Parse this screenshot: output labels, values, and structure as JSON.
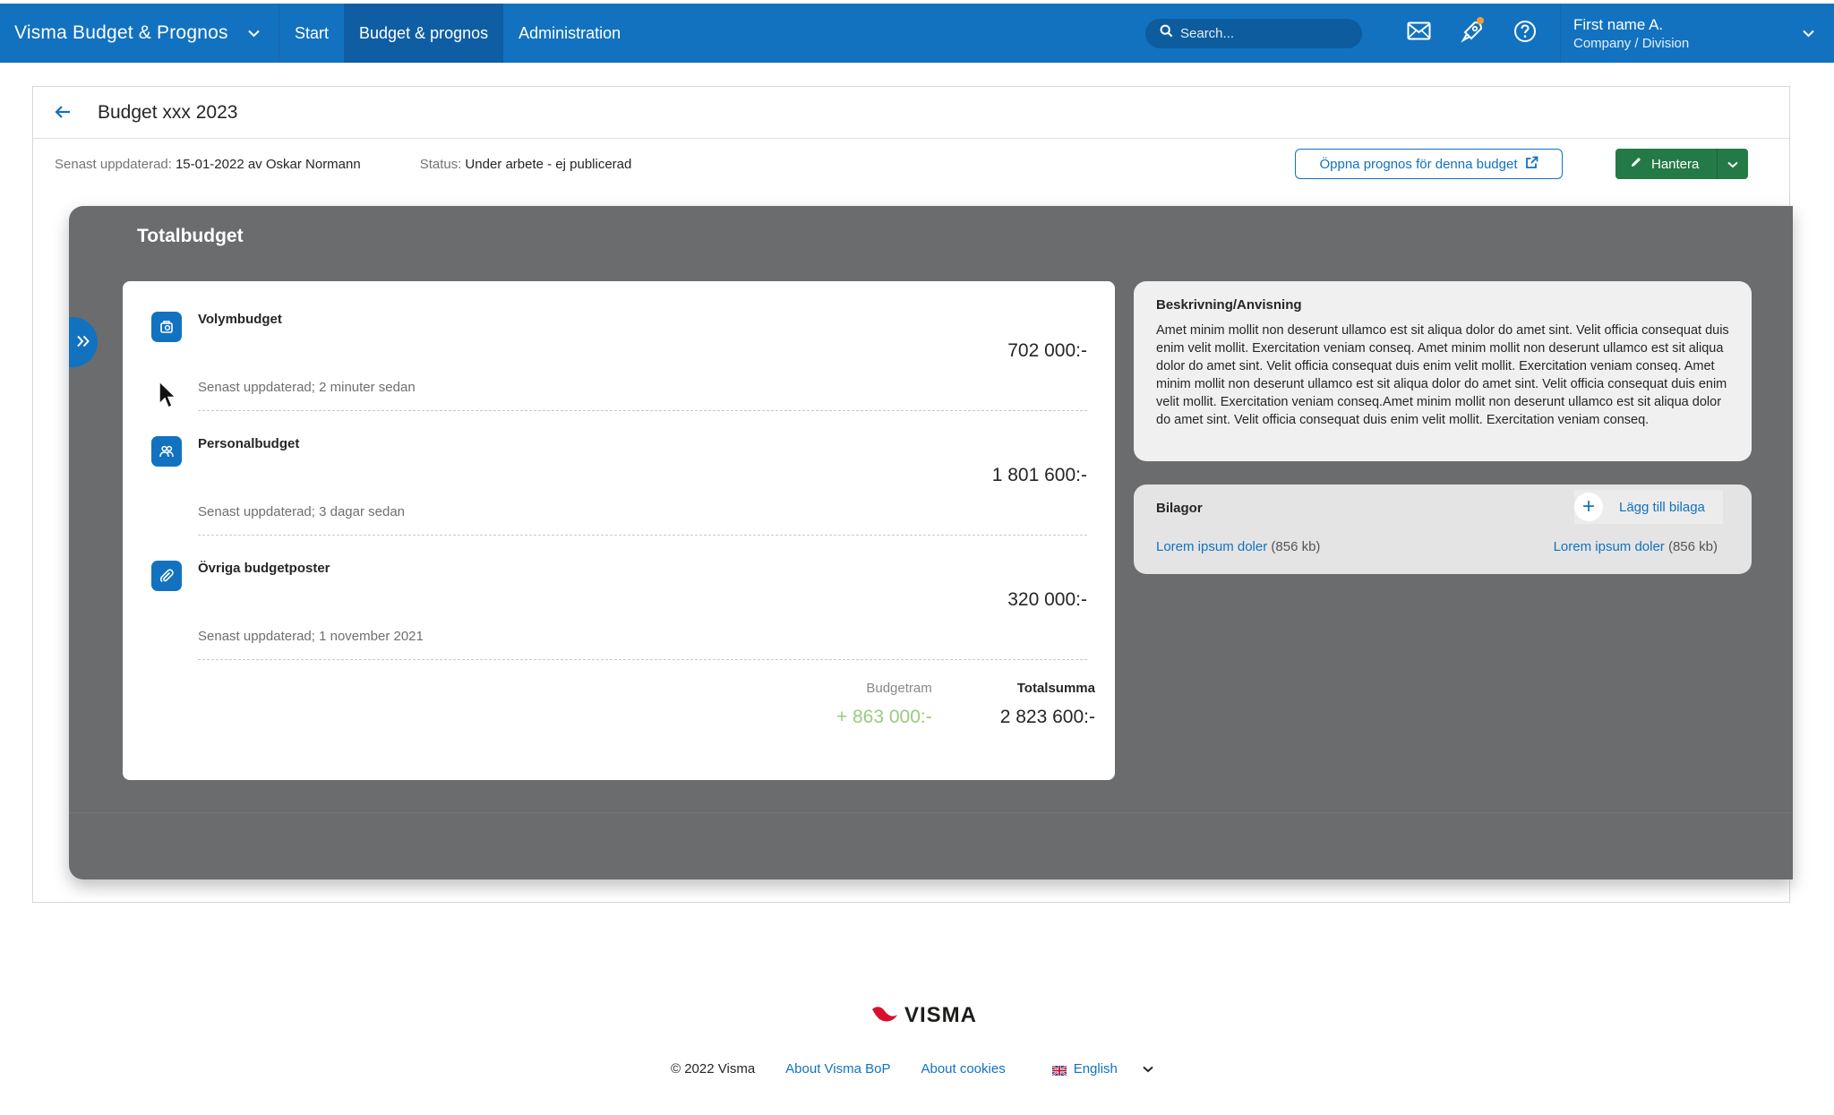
{
  "navbar": {
    "brand": "Visma  Budget & Prognos",
    "items": [
      {
        "label": "Start",
        "active": false
      },
      {
        "label": "Budget & prognos",
        "active": true
      },
      {
        "label": "Administration",
        "active": false
      }
    ],
    "search_placeholder": "Search...",
    "icons": [
      "mail-icon",
      "rocket-icon",
      "help-icon"
    ],
    "user_name": "First name A.",
    "user_company": "Company / Division",
    "colors": {
      "bar": "#1272bf",
      "active": "#0f5ea3",
      "notification": "#f29d38"
    }
  },
  "page": {
    "title": "Budget xxx 2023",
    "updated_label": "Senast uppdaterad:",
    "updated_value": "15-01-2022 av Oskar Normann",
    "status_label": "Status:",
    "status_value": "Under arbete - ej publicerad",
    "open_forecast_label": "Öppna  prognos för denna budget",
    "manage_label": "Hantera"
  },
  "panel": {
    "title": "Totalbudget",
    "items": [
      {
        "name": "Volymbudget",
        "amount": "702 000:-",
        "updated": "Senast uppdaterad; 2 minuter sedan",
        "icon": "volume-budget-icon"
      },
      {
        "name": "Personalbudget",
        "amount": "1 801 600:-",
        "updated": "Senast uppdaterad; 3 dagar sedan",
        "icon": "people-icon"
      },
      {
        "name": "Övriga budgetposter",
        "amount": "320 000:-",
        "updated": "Senast uppdaterad; 1 november 2021",
        "icon": "paperclip-icon"
      }
    ],
    "budgetram_label": "Budgetram",
    "budgetram_value": "+ 863 000:-",
    "total_label": "Totalsumma",
    "total_value": "2 823 600:-",
    "description_title": "Beskrivning/Anvisning",
    "description_text": "Amet minim mollit non deserunt ullamco est sit aliqua dolor do amet sint. Velit officia consequat duis enim velit mollit. Exercitation veniam conseq. Amet minim mollit non deserunt ullamco est sit aliqua dolor do amet sint. Velit officia consequat duis enim velit mollit. Exercitation veniam conseq. Amet minim mollit non deserunt ullamco est sit aliqua dolor do amet sint. Velit officia consequat duis enim velit mollit. Exercitation veniam conseq.Amet minim mollit non deserunt ullamco est sit aliqua dolor do amet sint. Velit officia consequat duis enim velit mollit. Exercitation veniam conseq.",
    "attachments_title": "Bilagor",
    "add_attachment_label": "Lägg till bilaga",
    "attachments": [
      {
        "name": "Lorem ipsum doler",
        "size": "(856 kb)"
      },
      {
        "name": "Lorem ipsum doler",
        "size": "(856 kb)"
      }
    ],
    "colors": {
      "overlay": "#6b6c6e",
      "green_amount": "#9acb80",
      "button_green": "#247a47"
    }
  },
  "footer": {
    "logo": "VISMA",
    "copyright": "© 2022 Visma",
    "links": [
      "About Visma BoP",
      "About cookies"
    ],
    "language": "English"
  }
}
